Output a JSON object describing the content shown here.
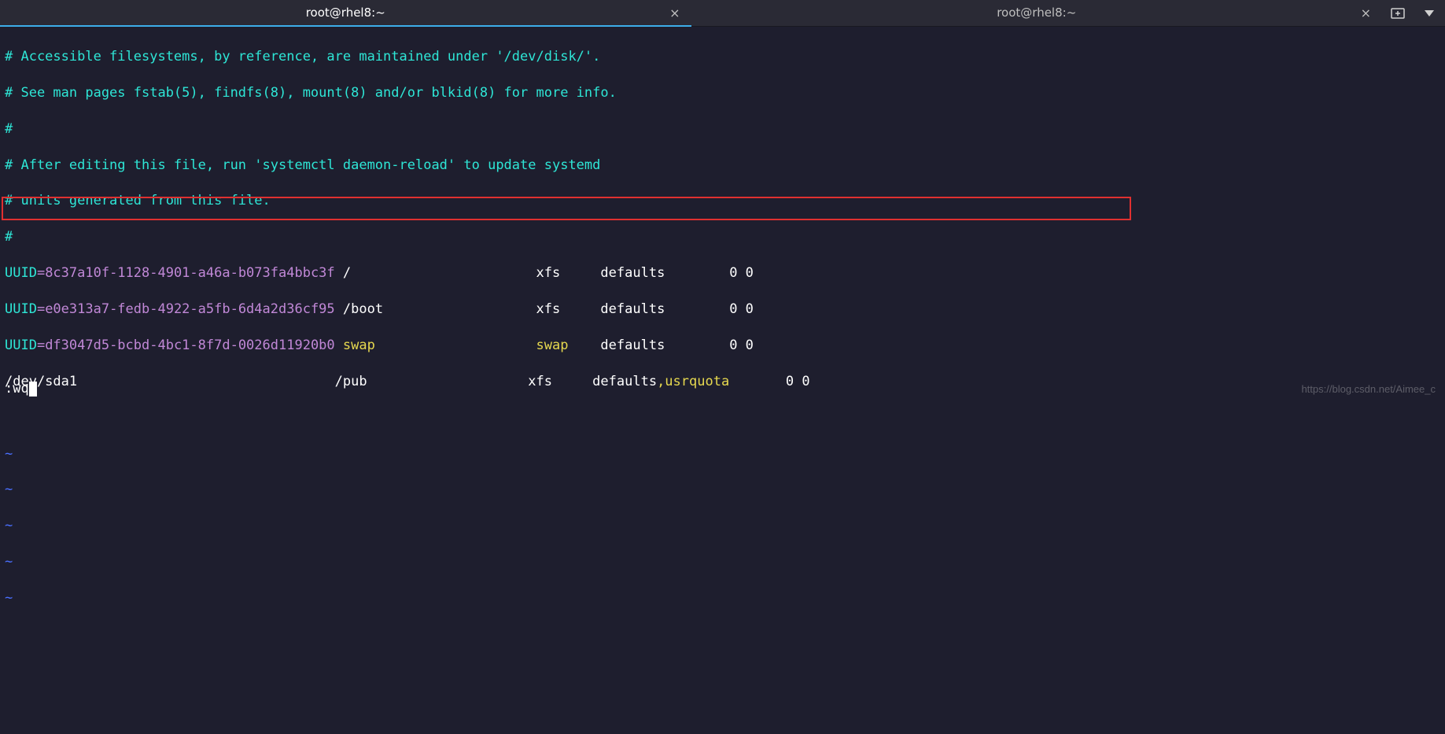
{
  "tabs": {
    "0": {
      "title": "root@rhel8:~"
    },
    "1": {
      "title": "root@rhel8:~"
    }
  },
  "comments": {
    "c1": "# Accessible filesystems, by reference, are maintained under '/dev/disk/'.",
    "c2": "# See man pages fstab(5), findfs(8), mount(8) and/or blkid(8) for more info.",
    "c3": "#",
    "c4": "# After editing this file, run 'systemctl daemon-reload' to update systemd",
    "c5": "# units generated from this file.",
    "c6": "#"
  },
  "uuid_label": "UUID",
  "fstab": {
    "r1": {
      "uuid": "=8c37a10f-1128-4901-a46a-b073fa4bbc3f",
      "mnt": " /                       ",
      "fs": "xfs     ",
      "opts": "defaults        ",
      "dump": "0 0"
    },
    "r2": {
      "uuid": "=e0e313a7-fedb-4922-a5fb-6d4a2d36cf95",
      "mnt": " /boot                   ",
      "fs": "xfs     ",
      "opts": "defaults        ",
      "dump": "0 0"
    },
    "r3": {
      "uuid": "=df3047d5-bcbd-4bc1-8f7d-0026d11920b0",
      "mnt_swap": " swap                    ",
      "fs_swap": "swap    ",
      "opts": "defaults        ",
      "dump": "0 0"
    },
    "r4": {
      "dev": "/dev/sda1                                ",
      "mnt": "/pub                    ",
      "fs": "xfs     ",
      "opts": "defaults",
      "opts2": ",usrquota",
      "pad": "       ",
      "dump": "0 0"
    }
  },
  "tilde": "~",
  "status_line": ":wq",
  "watermark": "https://blog.csdn.net/Aimee_c"
}
